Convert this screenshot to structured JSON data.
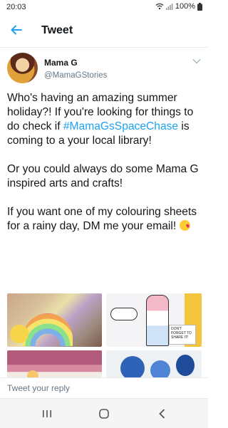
{
  "status_bar": {
    "time": "20:03",
    "battery": "100%"
  },
  "app_bar": {
    "title": "Tweet"
  },
  "tweet": {
    "author_name": "Mama G",
    "author_handle": "@MamaGStories",
    "para1_before": "Who's having an amazing summer holiday?! If you're looking for things to do check if ",
    "hashtag": "#MamaGsSpaceChase",
    "para1_after": " is coming to a your local library!",
    "para2": "Or you could always do some Mama G inspired arts and crafts!",
    "para3": "If you want one of my colouring sheets for a rainy day, DM me your email! "
  },
  "media": {
    "card_text": "DON'T FORGET TO SHARE IT!"
  },
  "reply": {
    "placeholder": "Tweet your reply"
  },
  "colors": {
    "accent": "#1da1f2",
    "text": "#14171a",
    "muted": "#657786"
  }
}
